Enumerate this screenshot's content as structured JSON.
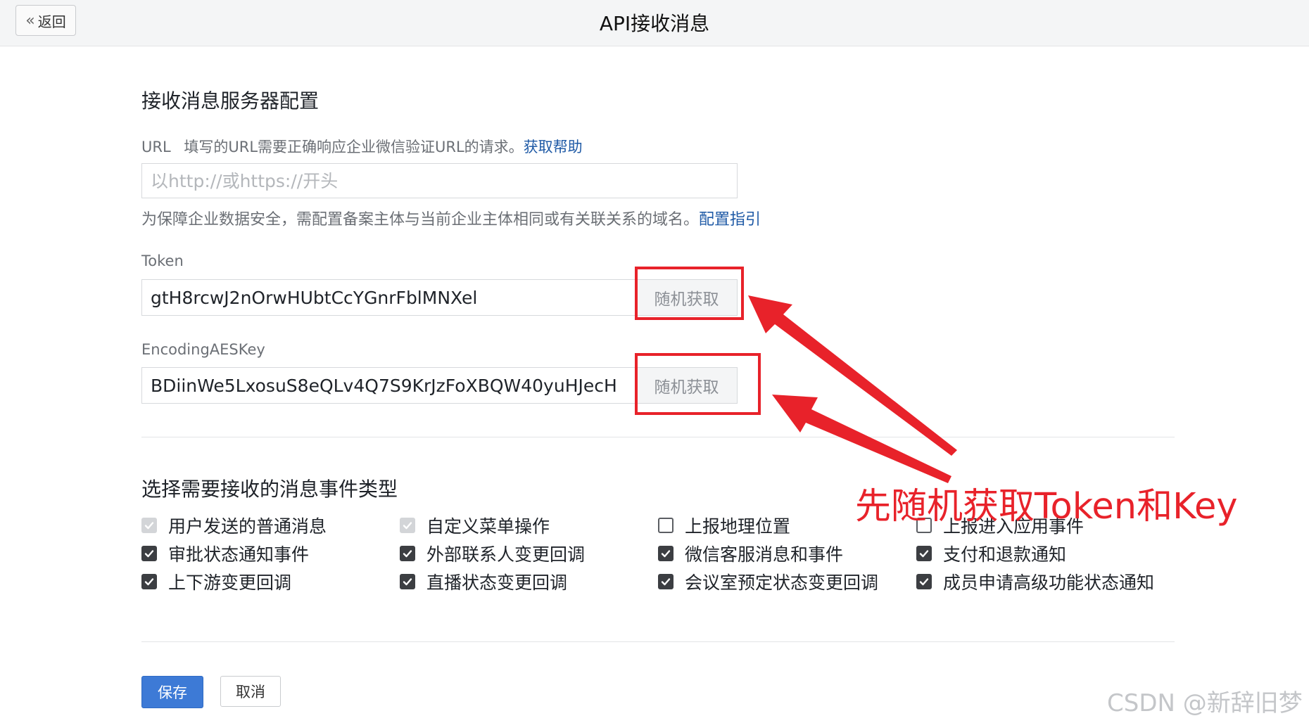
{
  "header": {
    "back_label": "返回",
    "back_icon": "double-chevron-left-icon",
    "title": "API接收消息"
  },
  "server_config": {
    "title": "接收消息服务器配置",
    "url": {
      "label": "URL",
      "desc": "填写的URL需要正确响应企业微信验证URL的请求。",
      "help_link": "获取帮助",
      "value": "",
      "placeholder": "以http://或https://开头",
      "hint": "为保障企业数据安全，需配置备案主体与当前企业主体相同或有关联关系的域名。",
      "hint_link": "配置指引"
    },
    "token": {
      "label": "Token",
      "value": "gtH8rcwJ2nOrwHUbtCcYGnrFblMNXel",
      "button": "随机获取"
    },
    "aes_key": {
      "label": "EncodingAESKey",
      "value": "BDiinWe5LxosuS8eQLv4Q7S9KrJzFoXBQW40yuHJecH",
      "button": "随机获取"
    }
  },
  "event_types": {
    "title": "选择需要接收的消息事件类型",
    "items": [
      {
        "label": "用户发送的普通消息",
        "checked": true,
        "disabled": true
      },
      {
        "label": "自定义菜单操作",
        "checked": true,
        "disabled": true
      },
      {
        "label": "上报地理位置",
        "checked": false,
        "disabled": false
      },
      {
        "label": "上报进入应用事件",
        "checked": false,
        "disabled": false
      },
      {
        "label": "审批状态通知事件",
        "checked": true,
        "disabled": false
      },
      {
        "label": "外部联系人变更回调",
        "checked": true,
        "disabled": false
      },
      {
        "label": "微信客服消息和事件",
        "checked": true,
        "disabled": false
      },
      {
        "label": "支付和退款通知",
        "checked": true,
        "disabled": false
      },
      {
        "label": "上下游变更回调",
        "checked": true,
        "disabled": false
      },
      {
        "label": "直播状态变更回调",
        "checked": true,
        "disabled": false
      },
      {
        "label": "会议室预定状态变更回调",
        "checked": true,
        "disabled": false
      },
      {
        "label": "成员申请高级功能状态通知",
        "checked": true,
        "disabled": false
      }
    ]
  },
  "annotation": {
    "text": "先随机获取Token和Key",
    "color": "#e8222a"
  },
  "footer": {
    "save_label": "保存",
    "cancel_label": "取消",
    "save_color": "#3d7ad6"
  },
  "watermark": "CSDN @新辞旧梦"
}
